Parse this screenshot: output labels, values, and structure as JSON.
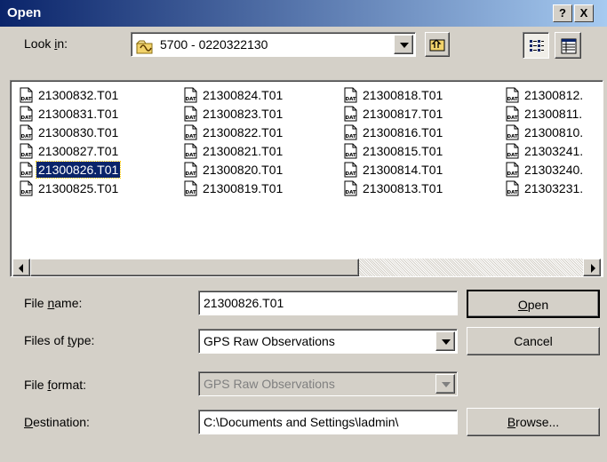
{
  "window": {
    "title": "Open",
    "help_label": "?",
    "close_label": "X"
  },
  "look_in": {
    "label_pre": "Look ",
    "label_key": "i",
    "label_post": "n:",
    "value": "5700 - 0220322130"
  },
  "files": [
    [
      "21300832.T01",
      "21300831.T01",
      "21300830.T01",
      "21300827.T01",
      "21300826.T01",
      "21300825.T01"
    ],
    [
      "21300824.T01",
      "21300823.T01",
      "21300822.T01",
      "21300821.T01",
      "21300820.T01",
      "21300819.T01"
    ],
    [
      "21300818.T01",
      "21300817.T01",
      "21300816.T01",
      "21300815.T01",
      "21300814.T01",
      "21300813.T01"
    ],
    [
      "21300812.",
      "21300811.",
      "21300810.",
      "21303241.",
      "21303240.",
      "21303231."
    ]
  ],
  "file_icon_text": "DAT",
  "file_name": {
    "label_pre": "File ",
    "label_key": "n",
    "label_post": "ame:",
    "value": "21300826.T01"
  },
  "file_type": {
    "label_pre": "Files of ",
    "label_key": "t",
    "label_post": "ype:",
    "value": "GPS Raw Observations"
  },
  "file_format": {
    "label_pre": "File ",
    "label_key": "f",
    "label_post": "ormat:",
    "value": "GPS Raw Observations"
  },
  "destination": {
    "label_pre": "",
    "label_key": "D",
    "label_post": "estination:",
    "value": "C:\\Documents and Settings\\ladmin\\"
  },
  "buttons": {
    "open_key": "O",
    "open_rest": "pen",
    "cancel": "Cancel",
    "browse_key": "B",
    "browse_rest": "rowse..."
  }
}
